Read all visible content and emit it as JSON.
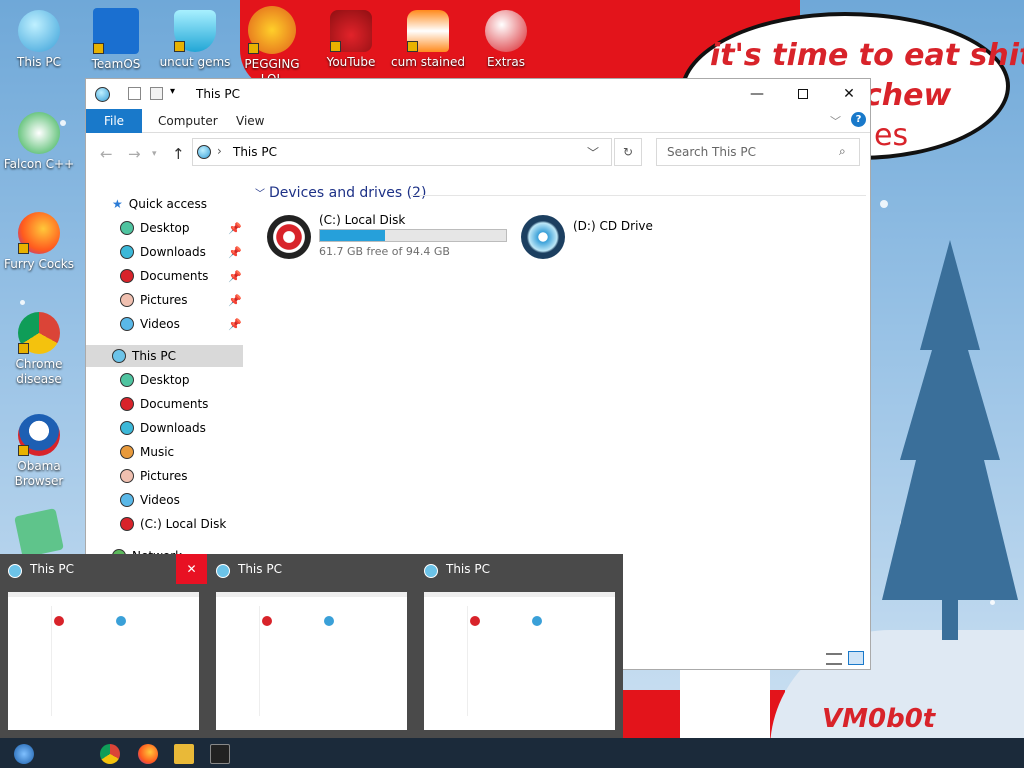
{
  "desktop": {
    "icons": [
      {
        "label": "This PC"
      },
      {
        "label": "TeamOS"
      },
      {
        "label": "uncut gems"
      },
      {
        "label": "PEGGING LOL"
      },
      {
        "label": "YouTube"
      },
      {
        "label": "cum stained"
      },
      {
        "label": "Extras"
      },
      {
        "label": "Falcon C++"
      },
      {
        "label": "Furry Cocks"
      },
      {
        "label": "Chrome disease"
      },
      {
        "label": "Obama Browser"
      }
    ],
    "bubble_lines": [
      "it's time to eat shit",
      "chew",
      "es"
    ],
    "signature": "VM0b0t"
  },
  "window": {
    "title": "This PC",
    "ribbon_tabs": [
      "File",
      "Computer",
      "View"
    ],
    "address": "This PC",
    "search_placeholder": "Search This PC",
    "nav": {
      "quick_access": "Quick access",
      "quick_items": [
        "Desktop",
        "Downloads",
        "Documents",
        "Pictures",
        "Videos"
      ],
      "this_pc": "This PC",
      "pc_items": [
        "Desktop",
        "Documents",
        "Downloads",
        "Music",
        "Pictures",
        "Videos",
        "(C:) Local Disk"
      ],
      "network": "Network"
    },
    "section_header": "Devices and drives (2)",
    "drives": [
      {
        "name": "(C:) Local Disk",
        "free_text": "61.7 GB free of 94.4 GB",
        "used_fraction": 0.35,
        "color": "#d8232a"
      },
      {
        "name": "(D:) CD Drive",
        "color": "#3aa0d8"
      }
    ]
  },
  "thumbnails": {
    "items": [
      "This PC",
      "This PC",
      "This PC"
    ],
    "close_glyph": "✕"
  },
  "colors": {
    "accent": "#1979ca",
    "close_red": "#e81123"
  }
}
